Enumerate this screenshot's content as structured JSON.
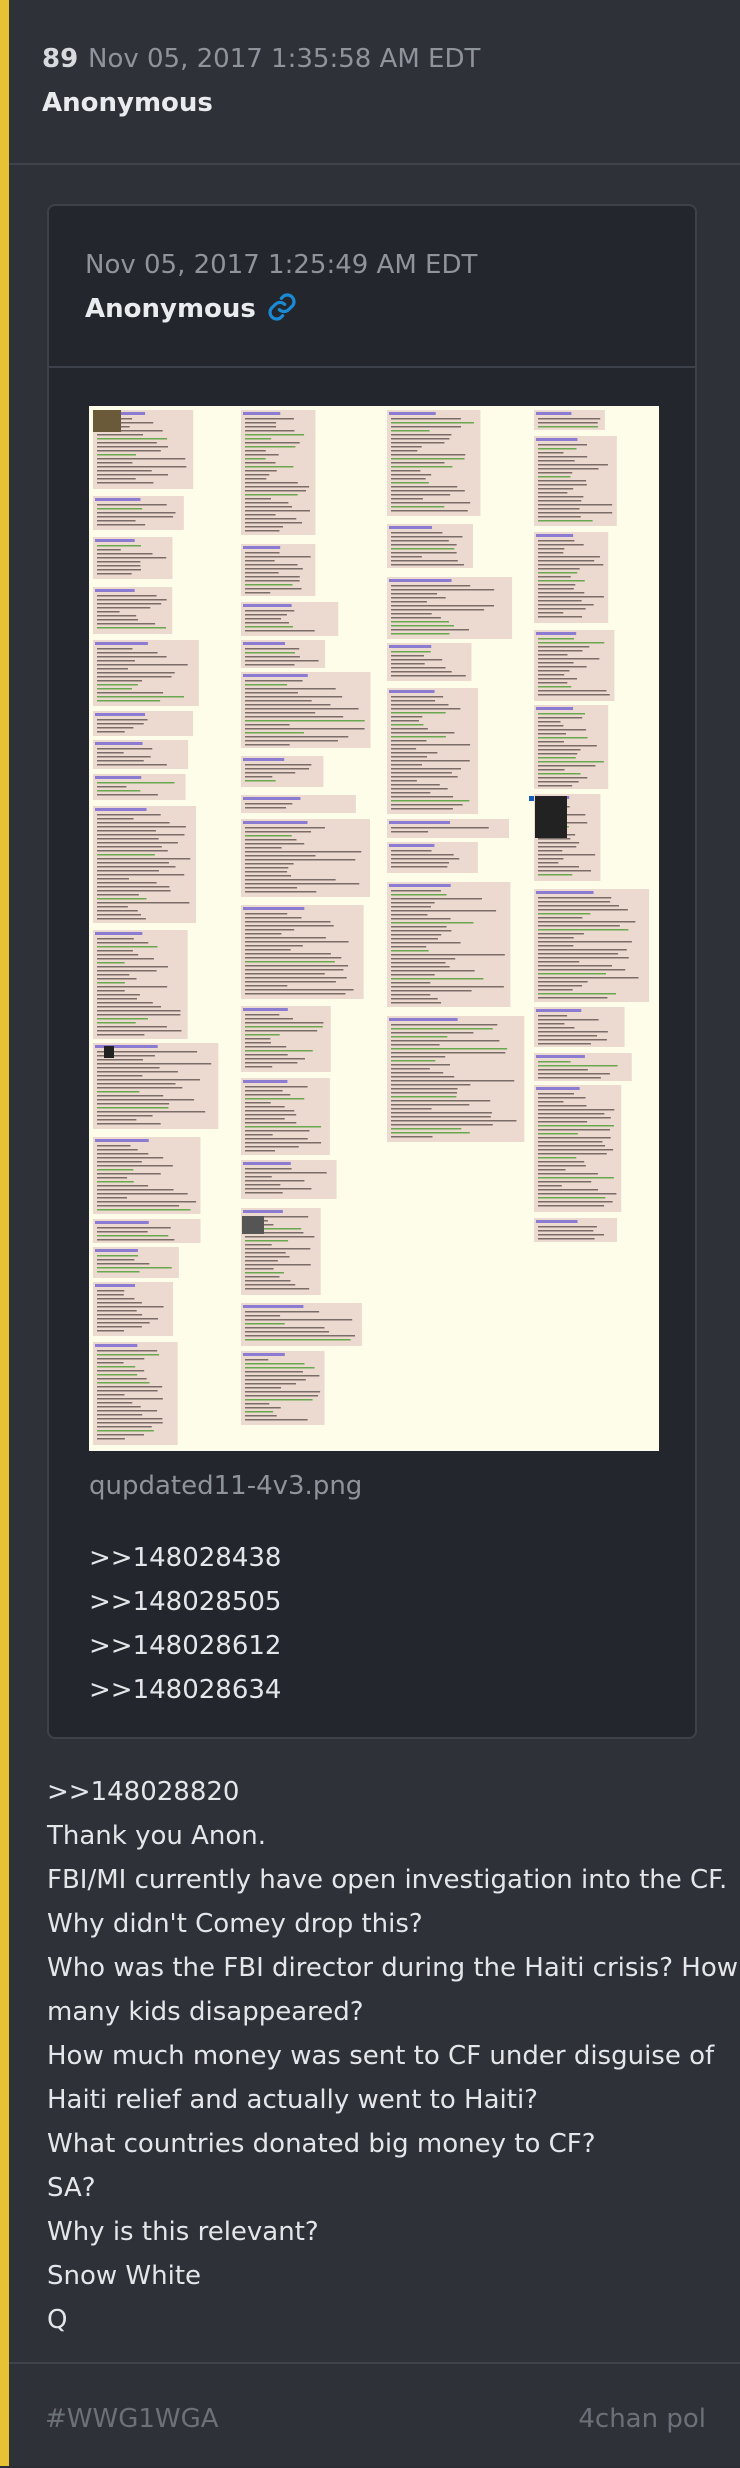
{
  "post": {
    "number": "89",
    "date": "Nov 05, 2017 1:35:58 AM EDT",
    "author": "Anonymous"
  },
  "quoted_post": {
    "date": "Nov 05, 2017 1:25:49 AM EDT",
    "author": "Anonymous",
    "link_icon": "link-icon",
    "image_filename": "qupdated11-4v3.png",
    "references": [
      ">>148028438",
      ">>148028505",
      ">>148028612",
      ">>148028634"
    ]
  },
  "body_lines": [
    ">>148028820",
    "Thank you Anon.",
    "FBI/MI currently have open investigation into the CF.",
    "Why didn't Comey drop this?",
    "Who was the FBI director during the Haiti crisis? How",
    "many kids disappeared?",
    "How much money was sent to CF under disguise of",
    "Haiti relief and actually went to Haiti?",
    "What countries donated big money to CF?",
    "SA?",
    "Why is this relevant?",
    "Snow White",
    "Q"
  ],
  "footer": {
    "tag": "#WWG1WGA",
    "board": "4chan pol"
  },
  "colors": {
    "accent_bar": "#e8c234",
    "link_icon": "#1a8ad4",
    "muted_text": "#8e939c"
  }
}
